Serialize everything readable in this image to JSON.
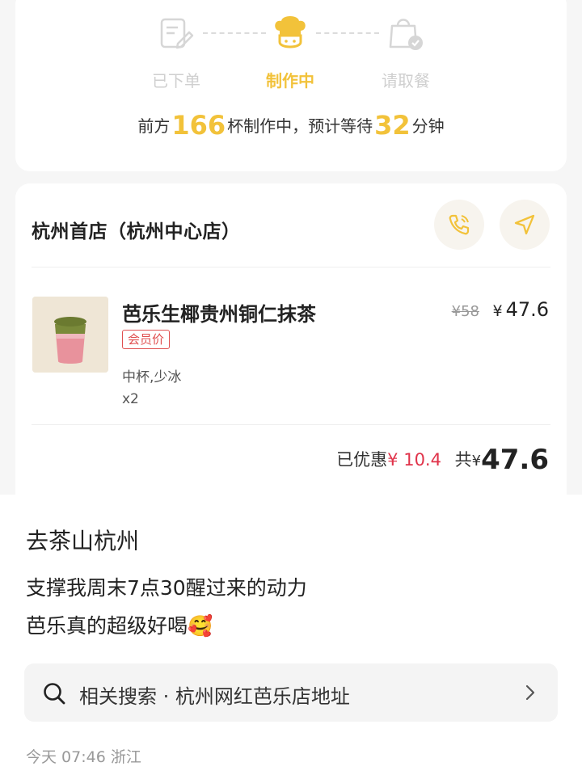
{
  "order_progress": {
    "steps": [
      {
        "label": "已下单",
        "state": "done",
        "icon": "order-form-icon"
      },
      {
        "label": "制作中",
        "state": "active",
        "icon": "chef-hat-icon"
      },
      {
        "label": "请取餐",
        "state": "pending",
        "icon": "pickup-bag-icon"
      }
    ],
    "queue_prefix": "前方",
    "queue_count": "166",
    "queue_mid": "杯制作中，预计等待",
    "wait_minutes": "32",
    "wait_suffix": "分钟"
  },
  "store": {
    "name": "杭州首店（杭州中心店）",
    "call_icon": "phone-icon",
    "nav_icon": "navigation-arrow-icon"
  },
  "item": {
    "name": "芭乐生椰贵州铜仁抹茶",
    "badge": "会员价",
    "spec": "中杯,少冰",
    "qty": "x2",
    "original_price": "¥58",
    "price_symbol": "¥",
    "price": "47.6"
  },
  "summary": {
    "discount_label": "已优惠",
    "discount_value": "¥ 10.4",
    "total_label": "共",
    "total_symbol": "¥",
    "total_value": "47.6"
  },
  "post": {
    "title": "去茶山杭州",
    "line1": "支撑我周末7点30醒过来的动力",
    "line2": "芭乐真的超级好喝🥰"
  },
  "related_search": {
    "text": "相关搜索 · 杭州网红芭乐店地址"
  },
  "meta": "今天 07:46 浙江",
  "colors": {
    "accent_yellow": "#f2c23a",
    "discount_red": "#e0334a",
    "muted_gray": "#cfcfcf"
  }
}
